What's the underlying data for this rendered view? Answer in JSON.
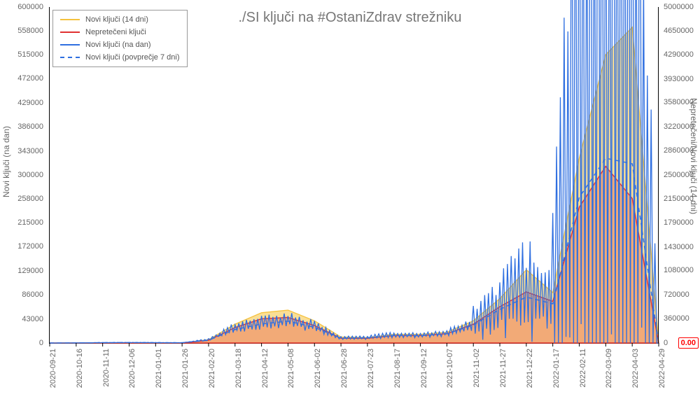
{
  "title": "./SI ključi na #OstaniZdrav strežniku",
  "y_left_label": "Novi ključi (na dan)",
  "y_right_label": "Nepretečeni/Novi ključi (14 dni)",
  "badge_value": "0.00",
  "colors": {
    "yellow": "#f5c23e",
    "red": "#e03131",
    "blue": "#2f6fe0",
    "dashed": "#2f6fe0"
  },
  "legend": [
    {
      "label": "Novi ključi (14 dni)",
      "color": "yellow",
      "style": "solid"
    },
    {
      "label": "Nepretečeni ključi",
      "color": "red",
      "style": "solid"
    },
    {
      "label": "Novi ključi (na dan)",
      "color": "blue",
      "style": "solid"
    },
    {
      "label": "Novi ključi (povprečje 7 dni)",
      "color": "dashed",
      "style": "dashed"
    }
  ],
  "y_left_ticks": [
    0,
    43000,
    86000,
    129000,
    172000,
    215000,
    258000,
    300000,
    343000,
    386000,
    429000,
    472000,
    515000,
    558000,
    600000
  ],
  "y_right_ticks": [
    0,
    360000,
    720000,
    1080000,
    1430000,
    1790000,
    2150000,
    2500000,
    2860000,
    3220000,
    3580000,
    3930000,
    4290000,
    4650000,
    5000000
  ],
  "x_ticks": [
    "2020-09-21",
    "2020-10-16",
    "2020-11-11",
    "2020-12-06",
    "2021-01-01",
    "2021-01-26",
    "2021-02-20",
    "2021-03-18",
    "2021-04-12",
    "2021-05-08",
    "2021-06-02",
    "2021-06-28",
    "2021-07-23",
    "2021-08-17",
    "2021-09-12",
    "2021-10-07",
    "2021-11-02",
    "2021-11-27",
    "2021-12-22",
    "2022-01-17",
    "2022-02-11",
    "2022-03-09",
    "2022-04-03",
    "2022-04-29"
  ],
  "chart_data": {
    "type": "line",
    "title": "./SI ključi na #OstaniZdrav strežniku",
    "xlabel": "",
    "ylabel_left": "Novi ključi (na dan)",
    "ylabel_right": "Nepretečeni/Novi ključi (14 dni)",
    "ylim_left": [
      0,
      600000
    ],
    "ylim_right": [
      0,
      5000000
    ],
    "legend_position": "upper left",
    "x": [
      "2020-09-21",
      "2020-10-16",
      "2020-11-11",
      "2020-12-06",
      "2021-01-01",
      "2021-01-26",
      "2021-02-20",
      "2021-03-18",
      "2021-04-12",
      "2021-05-08",
      "2021-06-02",
      "2021-06-28",
      "2021-07-23",
      "2021-08-17",
      "2021-09-12",
      "2021-10-07",
      "2021-11-02",
      "2021-11-27",
      "2021-12-22",
      "2022-01-17",
      "2022-02-11",
      "2022-03-09",
      "2022-04-03",
      "2022-04-29"
    ],
    "series": [
      {
        "name": "Novi ključi (14 dni)",
        "axis": "right",
        "color": "#f5c23e",
        "values": [
          0,
          1000,
          3000,
          4000,
          3000,
          2000,
          50000,
          280000,
          450000,
          490000,
          330000,
          90000,
          80000,
          130000,
          130000,
          160000,
          330000,
          660000,
          1090000,
          750000,
          2750000,
          4290000,
          4700000,
          0
        ]
      },
      {
        "name": "Nepretečeni ključi",
        "axis": "right",
        "color": "#e03131",
        "values": [
          0,
          800,
          2500,
          3500,
          2800,
          1800,
          40000,
          230000,
          360000,
          380000,
          260000,
          70000,
          70000,
          110000,
          110000,
          140000,
          280000,
          540000,
          760000,
          620000,
          2020000,
          2630000,
          2150000,
          0
        ]
      },
      {
        "name": "Novi ključi (na dan)",
        "axis": "left",
        "color": "#2f6fe0",
        "values": [
          0,
          200,
          700,
          900,
          700,
          500,
          6000,
          28000,
          36000,
          41000,
          30000,
          9000,
          10000,
          15000,
          14000,
          18000,
          35000,
          66000,
          95000,
          78000,
          410000,
          460000,
          520000,
          0
        ]
      },
      {
        "name": "Novi ključi (povprečje 7 dni)",
        "axis": "left",
        "color": "#2f6fe0",
        "style": "dashed",
        "values": [
          0,
          150,
          600,
          800,
          650,
          450,
          5000,
          24000,
          34000,
          39000,
          28000,
          8500,
          9000,
          13500,
          13000,
          16500,
          32000,
          60000,
          82000,
          70000,
          260000,
          330000,
          320000,
          0
        ]
      }
    ],
    "annotations": [
      {
        "text": "0.00",
        "axis": "right",
        "y": 0,
        "color": "#f00"
      }
    ]
  }
}
